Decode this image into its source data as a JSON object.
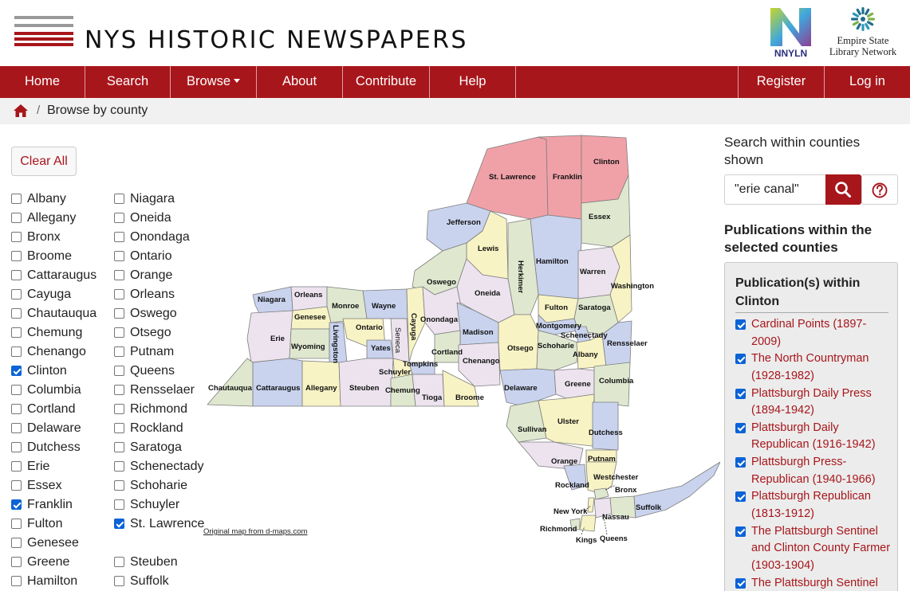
{
  "header": {
    "site_title": "NYS HISTORIC NEWSPAPERS",
    "partner_logo_1_text": "NNYLN",
    "partner_logo_2_line1": "Empire State",
    "partner_logo_2_line2": "Library Network"
  },
  "nav": {
    "items": [
      {
        "label": "Home"
      },
      {
        "label": "Search"
      },
      {
        "label": "Browse"
      },
      {
        "label": "About"
      },
      {
        "label": "Contribute"
      },
      {
        "label": "Help"
      }
    ],
    "right_items": [
      {
        "label": "Register"
      },
      {
        "label": "Log in"
      }
    ]
  },
  "breadcrumb": {
    "separator": "/",
    "current": "Browse by county"
  },
  "filters": {
    "clear_all_label": "Clear All",
    "column1": [
      {
        "label": "Albany",
        "checked": false
      },
      {
        "label": "Allegany",
        "checked": false
      },
      {
        "label": "Bronx",
        "checked": false
      },
      {
        "label": "Broome",
        "checked": false
      },
      {
        "label": "Cattaraugus",
        "checked": false
      },
      {
        "label": "Cayuga",
        "checked": false
      },
      {
        "label": "Chautauqua",
        "checked": false
      },
      {
        "label": "Chemung",
        "checked": false
      },
      {
        "label": "Chenango",
        "checked": false
      },
      {
        "label": "Clinton",
        "checked": true
      },
      {
        "label": "Columbia",
        "checked": false
      },
      {
        "label": "Cortland",
        "checked": false
      },
      {
        "label": "Delaware",
        "checked": false
      },
      {
        "label": "Dutchess",
        "checked": false
      },
      {
        "label": "Erie",
        "checked": false
      },
      {
        "label": "Essex",
        "checked": false
      },
      {
        "label": "Franklin",
        "checked": true
      },
      {
        "label": "Fulton",
        "checked": false
      },
      {
        "label": "Genesee",
        "checked": false
      },
      {
        "label": "Greene",
        "checked": false
      },
      {
        "label": "Hamilton",
        "checked": false
      }
    ],
    "column2": [
      {
        "label": "Niagara",
        "checked": false
      },
      {
        "label": "Oneida",
        "checked": false
      },
      {
        "label": "Onondaga",
        "checked": false
      },
      {
        "label": "Ontario",
        "checked": false
      },
      {
        "label": "Orange",
        "checked": false
      },
      {
        "label": "Orleans",
        "checked": false
      },
      {
        "label": "Oswego",
        "checked": false
      },
      {
        "label": "Otsego",
        "checked": false
      },
      {
        "label": "Putnam",
        "checked": false
      },
      {
        "label": "Queens",
        "checked": false
      },
      {
        "label": "Rensselaer",
        "checked": false
      },
      {
        "label": "Richmond",
        "checked": false
      },
      {
        "label": "Rockland",
        "checked": false
      },
      {
        "label": "Saratoga",
        "checked": false
      },
      {
        "label": "Schenectady",
        "checked": false
      },
      {
        "label": "Schoharie",
        "checked": false
      },
      {
        "label": "Schuyler",
        "checked": false
      },
      {
        "label": "St. Lawrence",
        "checked": true
      },
      {
        "label": "Steuben",
        "checked": false
      },
      {
        "label": "Suffolk",
        "checked": false
      }
    ]
  },
  "map": {
    "credit": "Original map from d-maps.com",
    "colors": {
      "selected": "#f0a1a8",
      "blue": "#c9d3ee",
      "green": "#dfe8cf",
      "yellow": "#f8f3c4",
      "lavender": "#ece3ee",
      "border": "#7d7d7d"
    },
    "labels": {
      "st_lawrence": "St. Lawrence",
      "franklin": "Franklin",
      "clinton": "Clinton",
      "jefferson": "Jefferson",
      "essex": "Essex",
      "lewis": "Lewis",
      "hamilton": "Hamilton",
      "herkimer": "Herkimer",
      "warren": "Warren",
      "washington": "Washington",
      "oswego": "Oswego",
      "oneida": "Oneida",
      "fulton": "Fulton",
      "saratoga": "Saratoga",
      "niagara": "Niagara",
      "orleans": "Orleans",
      "monroe": "Monroe",
      "wayne": "Wayne",
      "genesee": "Genesee",
      "onondaga": "Onondaga",
      "madison": "Madison",
      "montgomery": "Montgomery",
      "schenectady": "Schenectady",
      "rensselaer": "Rensselaer",
      "erie": "Erie",
      "wyoming": "Wyoming",
      "livingston": "Livingston",
      "ontario": "Ontario",
      "yates": "Yates",
      "seneca": "Seneca",
      "cayuga": "Cayuga",
      "cortland": "Cortland",
      "chenango": "Chenango",
      "otsego": "Otsego",
      "schoharie": "Schoharie",
      "albany": "Albany",
      "tompkins": "Tompkins",
      "schuyler": "Schuyler",
      "chautauqua": "Chautauqua",
      "cattaraugus": "Cattaraugus",
      "allegany": "Allegany",
      "steuben": "Steuben",
      "chemung": "Chemung",
      "tioga": "Tioga",
      "broome": "Broome",
      "delaware": "Delaware",
      "greene": "Greene",
      "columbia": "Columbia",
      "sullivan": "Sullivan",
      "ulster": "Ulster",
      "dutchess": "Dutchess",
      "orange": "Orange",
      "putnam": "Putnam",
      "rockland": "Rockland",
      "westchester": "Westchester",
      "bronx": "Bronx",
      "new_york": "New York",
      "nassau": "Nassau",
      "suffolk": "Suffolk",
      "richmond": "Richmond",
      "kings": "Kings",
      "queens": "Queens"
    }
  },
  "search": {
    "heading": "Search within counties shown",
    "value": "\"erie canal\""
  },
  "publications": {
    "heading": "Publications within the selected counties",
    "box_title": "Publication(s) within Clinton",
    "items": [
      {
        "title": "Cardinal Points (1897-2009)",
        "checked": true
      },
      {
        "title": "The North Countryman (1928-1982)",
        "checked": true
      },
      {
        "title": "Plattsburgh Daily Press (1894-1942)",
        "checked": true
      },
      {
        "title": "Plattsburgh Daily Republican (1916-1942)",
        "checked": true
      },
      {
        "title": "Plattsburgh Press-Republican (1940-1966)",
        "checked": true
      },
      {
        "title": "Plattsburgh Republican (1813-1912)",
        "checked": true
      },
      {
        "title": "The Plattsburgh Sentinel and Clinton County Farmer (1903-1904)",
        "checked": true
      },
      {
        "title": "The Plattsburgh Sentinel",
        "checked": true
      }
    ]
  }
}
